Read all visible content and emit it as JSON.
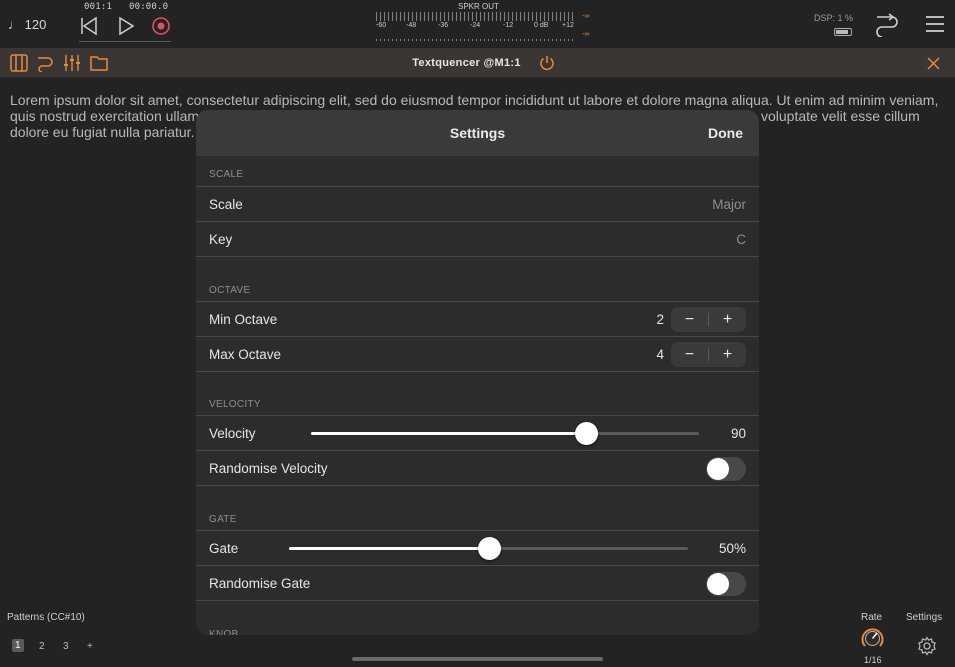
{
  "topbar": {
    "tempo": "♩ 120",
    "position": "001:1",
    "time": "00:00.0",
    "meter_title": "SPKR OUT",
    "meter_scale": [
      "-60",
      "-48",
      "-36",
      "-24",
      "-12",
      "0 dB",
      "+12"
    ],
    "meter_peak": "-∞",
    "dsp": "DSP: 1 %"
  },
  "plugin": {
    "title": "Textquencer @M1:1",
    "accent": "#e98a3a"
  },
  "lorem": "Lorem ipsum dolor sit amet, consectetur adipiscing elit, sed do eiusmod tempor incididunt ut labore et dolore magna aliqua. Ut enim ad minim veniam, quis nostrud exercitation ullam",
  "lorem_tail": "voluptate velit esse cillum",
  "lorem_line3": "dolore eu fugiat nulla pariatur.",
  "settings": {
    "title": "Settings",
    "done": "Done",
    "scale_section": "SCALE",
    "scale_label": "Scale",
    "scale_value": "Major",
    "key_label": "Key",
    "key_value": "C",
    "octave_section": "OCTAVE",
    "min_octave_label": "Min Octave",
    "min_octave_value": "2",
    "max_octave_label": "Max Octave",
    "max_octave_value": "4",
    "stepper_minus": "−",
    "stepper_plus": "+",
    "velocity_section": "VELOCITY",
    "velocity_label": "Velocity",
    "velocity_value": "90",
    "velocity_fraction": 0.7087,
    "rand_velocity_label": "Randomise Velocity",
    "rand_velocity_on": false,
    "gate_section": "GATE",
    "gate_label": "Gate",
    "gate_value": "50%",
    "gate_fraction": 0.5,
    "rand_gate_label": "Randomise Gate",
    "rand_gate_on": false,
    "knob_section": "KNOB"
  },
  "bottom": {
    "patterns_label": "Patterns (CC#10)",
    "patterns": [
      "1",
      "2",
      "3",
      "+"
    ],
    "rate_label": "Rate",
    "rate_value": "1/16",
    "settings_label": "Settings"
  }
}
